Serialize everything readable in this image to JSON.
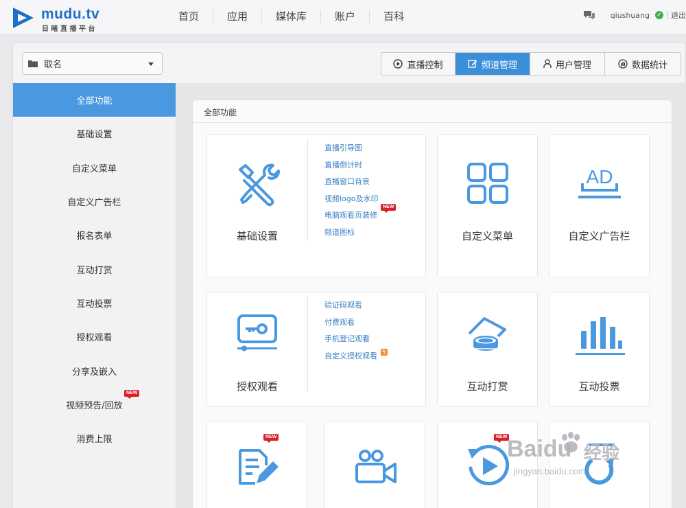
{
  "brand": {
    "name": "mudu.tv",
    "tagline": "目睹直播平台",
    "color": "#1f6fc9"
  },
  "nav": [
    "首页",
    "应用",
    "媒体库",
    "账户",
    "百科"
  ],
  "user": {
    "name": "qiushuang",
    "logout": "退出"
  },
  "channel_select": {
    "value": "取名",
    "icon": "folder-icon"
  },
  "tabs": [
    {
      "label": "直播控制",
      "icon": "play-circle-icon"
    },
    {
      "label": "频道管理",
      "icon": "edit-icon",
      "active": true
    },
    {
      "label": "用户管理",
      "icon": "user-icon"
    },
    {
      "label": "数据统计",
      "icon": "chart-icon"
    }
  ],
  "sidebar": {
    "items": [
      {
        "label": "全部功能",
        "active": true
      },
      {
        "label": "基础设置"
      },
      {
        "label": "自定义菜单"
      },
      {
        "label": "自定义广告栏"
      },
      {
        "label": "报名表单"
      },
      {
        "label": "互动打赏"
      },
      {
        "label": "互动投票"
      },
      {
        "label": "授权观看"
      },
      {
        "label": "分享及嵌入"
      },
      {
        "label": "视频预告/回放",
        "badge": "NEW"
      },
      {
        "label": "消费上限"
      }
    ]
  },
  "main": {
    "section_title": "全部功能",
    "basic": {
      "label": "基础设置",
      "links": [
        "直播引导图",
        "直播倒计时",
        "直播窗口背景",
        "视频logo及水印",
        "电脑观看页装修",
        "频道图标"
      ],
      "new_badge": "NEW"
    },
    "menu": {
      "label": "自定义菜单",
      "icon_text": ""
    },
    "ad": {
      "label": "自定义广告栏",
      "icon_text": "AD"
    },
    "auth": {
      "label": "授权观看",
      "links": [
        "验证码观看",
        "付费观看",
        "手机登记观看",
        "自定义授权观看"
      ],
      "badge": "专"
    },
    "reward": {
      "label": "互动打赏"
    },
    "vote": {
      "label": "互动投票"
    },
    "row3_badges": [
      "NEW",
      "NEW"
    ]
  },
  "watermark": {
    "brand": "Baidu",
    "cn": "经验",
    "url": "jingyan.baidu.com"
  },
  "colors": {
    "accent": "#3b8ed8",
    "icon": "#4a99e0",
    "link": "#3a7fc6",
    "new": "#d9202a"
  }
}
